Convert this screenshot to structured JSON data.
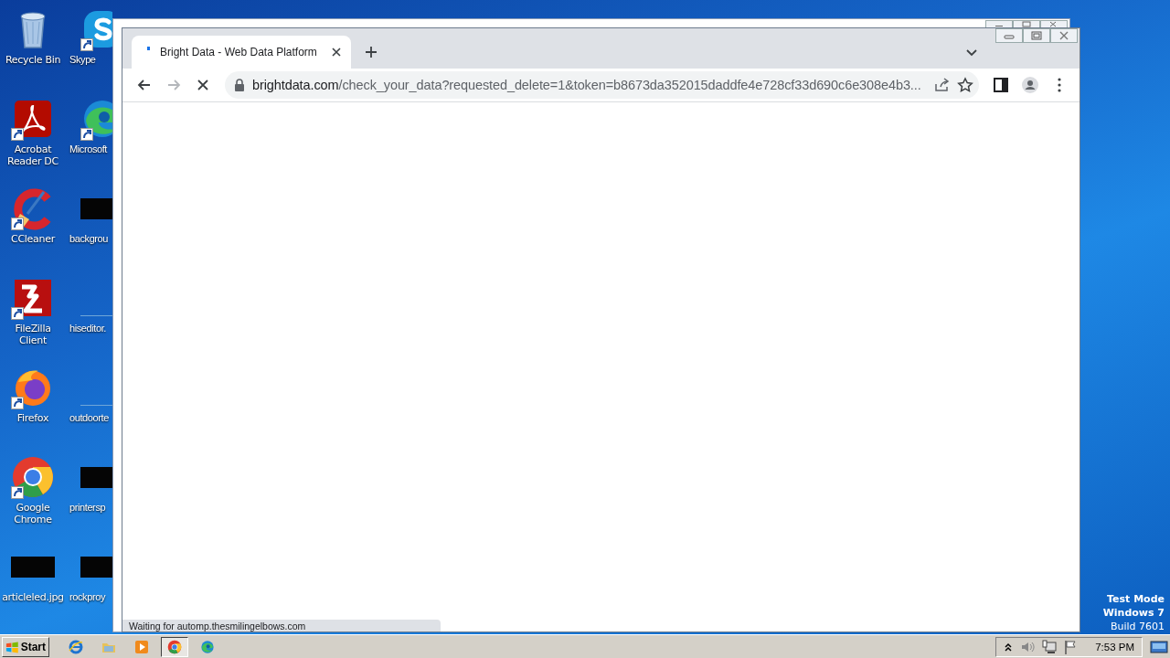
{
  "desktop": {
    "icons": [
      {
        "label": "Recycle Bin",
        "kind": "recycle",
        "shortcut": false
      },
      {
        "label": "Skype",
        "kind": "skype",
        "shortcut": true
      },
      {
        "label": "Acrobat Reader DC",
        "kind": "pdf",
        "shortcut": true
      },
      {
        "label": "Microsoft",
        "kind": "edge",
        "shortcut": true
      },
      {
        "label": "CCleaner",
        "kind": "ccleaner",
        "shortcut": true
      },
      {
        "label": "backgrou",
        "kind": "thumb",
        "shortcut": false
      },
      {
        "label": "FileZilla Client",
        "kind": "filezilla",
        "shortcut": true
      },
      {
        "label": "hiseditor.",
        "kind": "blank",
        "shortcut": false
      },
      {
        "label": "Firefox",
        "kind": "firefox",
        "shortcut": true
      },
      {
        "label": "outdoorte",
        "kind": "blank",
        "shortcut": false
      },
      {
        "label": "Google Chrome",
        "kind": "chrome",
        "shortcut": true
      },
      {
        "label": "printersp",
        "kind": "thumb",
        "shortcut": false
      },
      {
        "label": "articleled.jpg",
        "kind": "thumb",
        "shortcut": false
      },
      {
        "label": "rockproy",
        "kind": "thumb",
        "shortcut": false
      }
    ],
    "os_notice": [
      "Test Mode",
      "Windows 7",
      "Build 7601"
    ]
  },
  "browser": {
    "tabs": [
      {
        "title": "Bright Data - Web Data Platform",
        "selected": true,
        "loading": true
      }
    ],
    "nav": [
      {
        "kind": "back",
        "disabled": false
      },
      {
        "kind": "forward",
        "disabled": true
      },
      {
        "kind": "stop",
        "disabled": false
      }
    ],
    "address": {
      "host": "brightdata.com",
      "path": "/check_your_data?requested_delete=1&token=b8673da352015daddfe4e728cf33d690c6e308e4b3..."
    },
    "status": "Waiting for automp.thesmilingelbows.com"
  },
  "taskbar": {
    "start": "Start",
    "items": [
      {
        "kind": "ie",
        "selected": false
      },
      {
        "kind": "folder",
        "selected": false
      },
      {
        "kind": "media",
        "selected": false
      },
      {
        "kind": "chrome",
        "selected": true
      },
      {
        "kind": "edge",
        "selected": false
      }
    ],
    "clock": "7:53 PM"
  }
}
